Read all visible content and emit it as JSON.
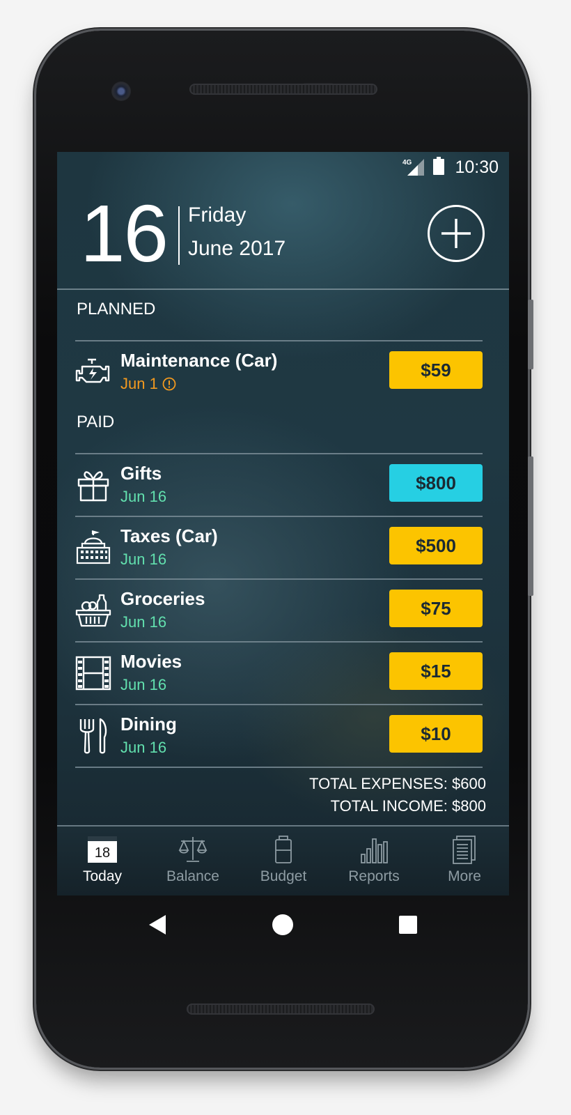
{
  "status": {
    "network": "4G",
    "time": "10:30"
  },
  "header": {
    "day_number": "16",
    "weekday": "Friday",
    "month_year": "June 2017"
  },
  "planned": {
    "title": "PLANNED",
    "items": [
      {
        "title": "Maintenance (Car)",
        "date": "Jun 1",
        "amount": "$59",
        "icon": "engine-icon",
        "overdue": true
      }
    ]
  },
  "paid": {
    "title": "PAID",
    "items": [
      {
        "title": "Gifts",
        "date": "Jun 16",
        "amount": "$800",
        "icon": "gift-icon",
        "type": "income"
      },
      {
        "title": "Taxes (Car)",
        "date": "Jun 16",
        "amount": "$500",
        "icon": "government-building-icon",
        "type": "expense"
      },
      {
        "title": "Groceries",
        "date": "Jun 16",
        "amount": "$75",
        "icon": "grocery-basket-icon",
        "type": "expense"
      },
      {
        "title": "Movies",
        "date": "Jun 16",
        "amount": "$15",
        "icon": "film-icon",
        "type": "expense"
      },
      {
        "title": "Dining",
        "date": "Jun 16",
        "amount": "$10",
        "icon": "fork-knife-icon",
        "type": "expense"
      }
    ]
  },
  "totals": {
    "expenses_label": "TOTAL EXPENSES:",
    "expenses_value": "$600",
    "income_label": "TOTAL INCOME:",
    "income_value": "$800"
  },
  "tabs": [
    {
      "label": "Today",
      "icon": "calendar-icon",
      "icon_text": "18",
      "active": true
    },
    {
      "label": "Balance",
      "icon": "scales-icon",
      "active": false
    },
    {
      "label": "Budget",
      "icon": "battery-jar-icon",
      "active": false
    },
    {
      "label": "Reports",
      "icon": "bar-chart-icon",
      "active": false
    },
    {
      "label": "More",
      "icon": "documents-icon",
      "active": false
    }
  ],
  "colors": {
    "expense_badge": "#fcc400",
    "income_badge": "#26cfe3",
    "paid_date": "#62e0ae",
    "overdue_date": "#f39a1f"
  }
}
